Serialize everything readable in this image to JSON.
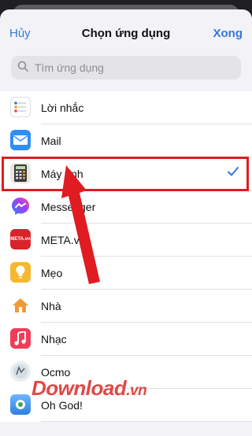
{
  "colors": {
    "accent": "#3478d6",
    "highlight": "#e01b22",
    "background": "#f2f2f7"
  },
  "navbar": {
    "cancel_label": "Hủy",
    "title": "Chọn ứng dụng",
    "done_label": "Xong"
  },
  "search": {
    "placeholder": "Tìm ứng dụng",
    "icon": "search-icon"
  },
  "apps": [
    {
      "label": "Lời nhắc",
      "icon": "reminders-icon",
      "selected": false
    },
    {
      "label": "Mail",
      "icon": "mail-icon",
      "selected": false
    },
    {
      "label": "Máy tính",
      "icon": "calculator-icon",
      "selected": true
    },
    {
      "label": "Messenger",
      "icon": "messenger-icon",
      "selected": false
    },
    {
      "label": "META.vn",
      "icon": "meta-icon",
      "selected": false
    },
    {
      "label": "Mẹo",
      "icon": "tips-icon",
      "selected": false
    },
    {
      "label": "Nhà",
      "icon": "home-icon",
      "selected": false
    },
    {
      "label": "Nhạc",
      "icon": "music-icon",
      "selected": false
    },
    {
      "label": "Ocmo",
      "icon": "ocmo-icon",
      "selected": false
    },
    {
      "label": "Oh God!",
      "icon": "ohgod-icon",
      "selected": false
    }
  ],
  "meta_icon_text": "META.vn",
  "watermark": {
    "brand": "Download",
    "tld": ".vn"
  }
}
